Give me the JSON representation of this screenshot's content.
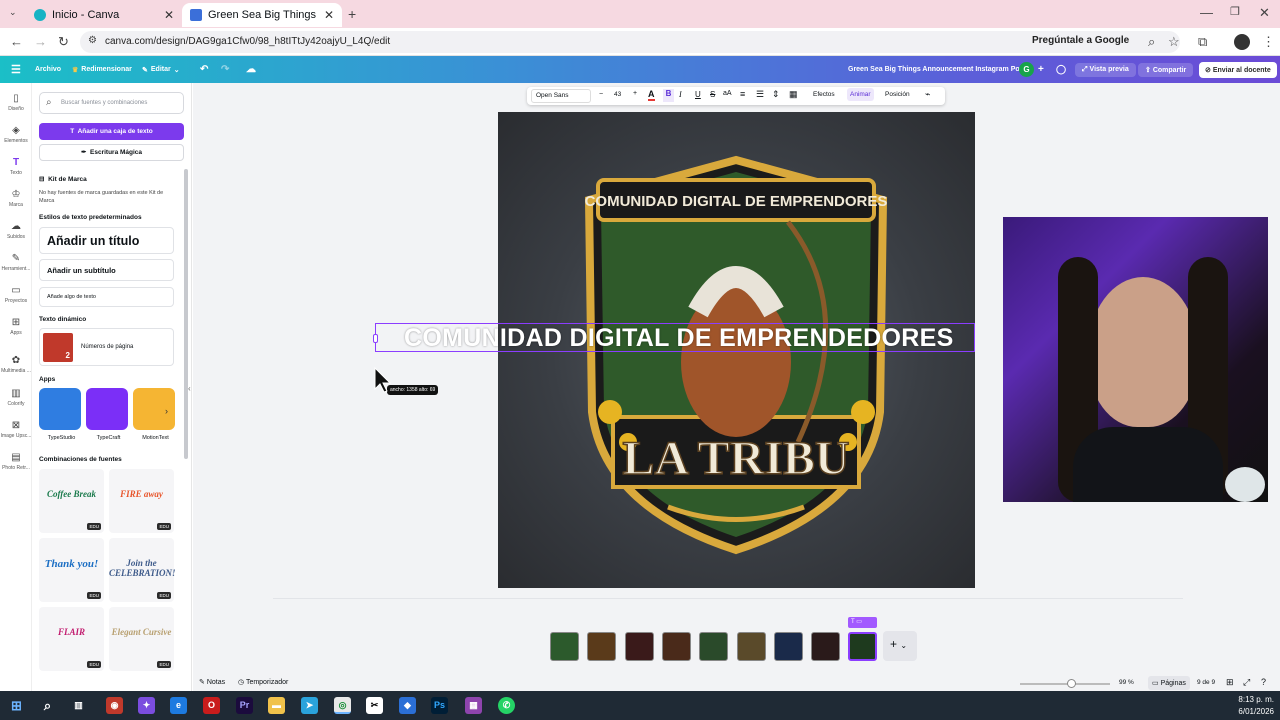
{
  "browser": {
    "tabs": [
      {
        "label": "Inicio - Canva"
      },
      {
        "label": "Green Sea Big Things Announc"
      }
    ],
    "url": "canva.com/design/DAG9ga1Cfw0/98_h8tITtJy42oajyU_L4Q/edit",
    "google_button": "Pregúntale a Google"
  },
  "toolbar": {
    "archivo": "Archivo",
    "redimensionar": "Redimensionar",
    "editar": "Editar",
    "design_title": "Green Sea Big Things Announcement Instagram Post",
    "avatar": "G",
    "vista_previa": "Vista previa",
    "compartir": "Compartir",
    "enviar": "Enviar al docente"
  },
  "text_toolbar": {
    "font": "Open Sans",
    "minus": "−",
    "size": "43",
    "plus": "+",
    "efectos": "Efectos",
    "animar": "Animar",
    "posicion": "Posición"
  },
  "rail": [
    {
      "label": "Diseño",
      "icon": "▯"
    },
    {
      "label": "Elementos",
      "icon": "◈"
    },
    {
      "label": "Texto",
      "icon": "T"
    },
    {
      "label": "Marca",
      "icon": "♔"
    },
    {
      "label": "Subidos",
      "icon": "☁"
    },
    {
      "label": "Herramient...",
      "icon": "✎"
    },
    {
      "label": "Proyectos",
      "icon": "▭"
    },
    {
      "label": "Apps",
      "icon": "⊞"
    },
    {
      "label": "Multimedia ...",
      "icon": "✿"
    },
    {
      "label": "Colorify",
      "icon": "▥"
    },
    {
      "label": "Image Upsc...",
      "icon": "⊠"
    },
    {
      "label": "Photo Retr...",
      "icon": "▤"
    }
  ],
  "panel": {
    "search_placeholder": "Buscar fuentes y combinaciones",
    "add_textbox": "Añadir una caja de texto",
    "magic_write": "Escritura Mágica",
    "brand_kit_title": "Kit de Marca",
    "brand_kit_text": "No hay fuentes de marca guardadas en este Kit de Marca",
    "default_styles": "Estilos de texto predeterminados",
    "add_title": "Añadir un título",
    "add_subtitle": "Añadir un subtítulo",
    "add_body": "Añade algo de texto",
    "dynamic_text": "Texto dinámico",
    "page_numbers": "Números de página",
    "apps_title": "Apps",
    "apps": [
      {
        "name": "TypeStudio",
        "color": "#2f7de1"
      },
      {
        "name": "TypeCraft",
        "color": "#7b2ff7"
      },
      {
        "name": "MotionText",
        "color": "#f5b533"
      }
    ],
    "font_combos_title": "Combinaciones de fuentes",
    "combos": [
      {
        "text": "Coffee Break",
        "color": "#1a7a4c"
      },
      {
        "text": "FIRE away",
        "color": "#e8542a"
      },
      {
        "text": "Thank you!",
        "color": "#1c6fc4"
      },
      {
        "text": "Join the CELEBRATION!",
        "color": "#3d5a8a"
      },
      {
        "text": "FLAIR",
        "color": "#c21c6f"
      },
      {
        "text": "Elegant Cursive",
        "color": "#b8a070"
      }
    ],
    "edu_badge": "EDU"
  },
  "canvas": {
    "overlay_text": "COMUNIDAD DIGITAL DE EMPRENDEDORES",
    "size_tooltip": "ancho: 1358 alto: 69",
    "logo_top_text": "COMUNIDAD DIGITAL DE EMPRENDORES",
    "logo_bottom_text": "LA TRIBU"
  },
  "bottom": {
    "notas": "Notas",
    "temporizador": "Temporizador",
    "zoom": "99 %",
    "paginas": "Páginas",
    "page_count": "9 de 9",
    "page_badge": "T"
  },
  "thumbnails": [
    {
      "color": "#2c5a2c"
    },
    {
      "color": "#5a3a1a"
    },
    {
      "color": "#3a1a1a"
    },
    {
      "color": "#4a2a1a"
    },
    {
      "color": "#2a4a2a"
    },
    {
      "color": "#5a4a2a"
    },
    {
      "color": "#1a2a4a"
    },
    {
      "color": "#2a1a1a"
    },
    {
      "color": "#1e3a1e"
    }
  ],
  "taskbar": {
    "time": "8:13 p. m.",
    "date": "6/01/2026"
  }
}
